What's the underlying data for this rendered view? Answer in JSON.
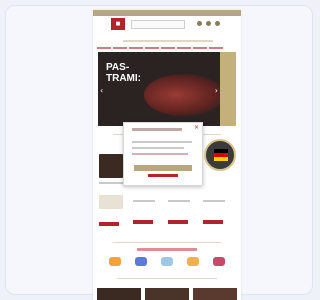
{
  "hero": {
    "title_line1": "PAS-",
    "title_line2": "TRAMI:"
  },
  "carousel": {
    "prev_icon": "chevron-left-icon",
    "next_icon": "chevron-right-icon"
  },
  "modal": {
    "close_glyph": "×"
  },
  "colors": {
    "brand_red": "#b3232a",
    "brand_gold": "#b7a680",
    "hero_bg": "#2b2322"
  }
}
